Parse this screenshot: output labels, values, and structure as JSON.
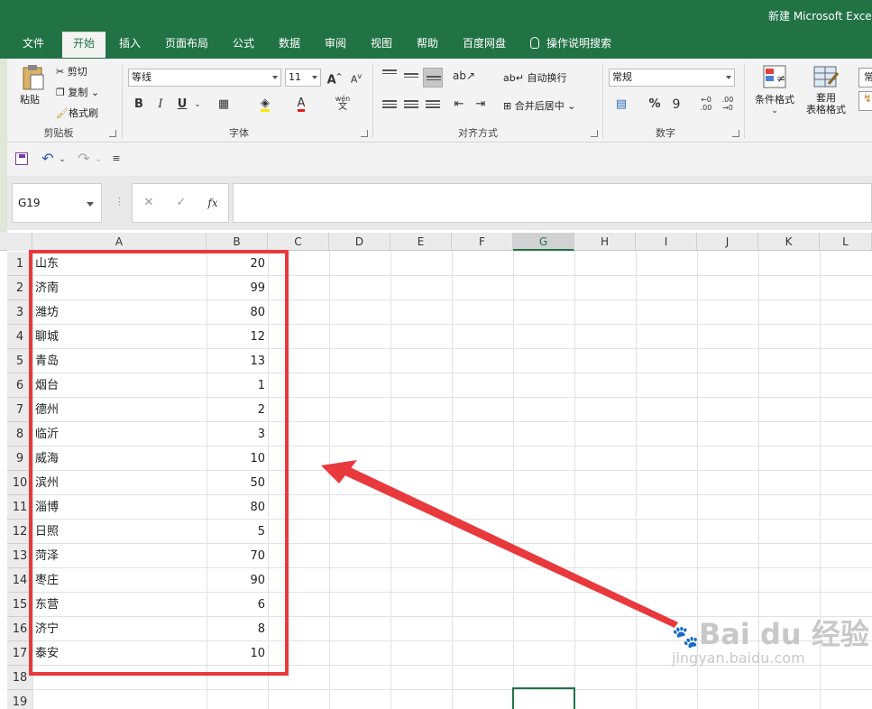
{
  "window": {
    "title": "新建 Microsoft Exce"
  },
  "tabs": [
    "文件",
    "开始",
    "插入",
    "页面布局",
    "公式",
    "数据",
    "审阅",
    "视图",
    "帮助",
    "百度网盘"
  ],
  "active_tab": "开始",
  "tell_me": "操作说明搜索",
  "ribbon": {
    "clipboard": {
      "paste": "粘贴",
      "cut": "剪切",
      "copy": "复制",
      "format_painter": "格式刷",
      "label": "剪贴板"
    },
    "font": {
      "name": "等线",
      "size": "11",
      "bold": "B",
      "italic": "I",
      "underline": "U",
      "increase": "A",
      "decrease": "A",
      "font_color": "A",
      "phonetic_top": "wén",
      "phonetic_bottom": "文",
      "label": "字体"
    },
    "alignment": {
      "wrap": "自动换行",
      "merge": "合并后居中",
      "label": "对齐方式"
    },
    "number": {
      "format": "常规",
      "percent": "%",
      "comma": "9",
      "inc_decimal_top": "←0",
      "inc_decimal_bottom": ".00",
      "dec_decimal_top": ".00",
      "dec_decimal_bottom": "→0",
      "label": "数字"
    },
    "styles": {
      "conditional": "条件格式",
      "table_line1": "套用",
      "table_line2": "表格格式",
      "cell_style": "常"
    }
  },
  "formula_bar": {
    "name_box": "G19",
    "cancel": "✕",
    "enter": "✓",
    "fx": "fx",
    "value": ""
  },
  "columns": [
    "A",
    "B",
    "C",
    "D",
    "E",
    "F",
    "G",
    "H",
    "I",
    "J",
    "K",
    "L"
  ],
  "selected_column": "G",
  "rows": [
    {
      "n": "1",
      "a": "山东",
      "b": "20"
    },
    {
      "n": "2",
      "a": "济南",
      "b": "99"
    },
    {
      "n": "3",
      "a": "潍坊",
      "b": "80"
    },
    {
      "n": "4",
      "a": "聊城",
      "b": "12"
    },
    {
      "n": "5",
      "a": "青岛",
      "b": "13"
    },
    {
      "n": "6",
      "a": "烟台",
      "b": "1"
    },
    {
      "n": "7",
      "a": "德州",
      "b": "2"
    },
    {
      "n": "8",
      "a": "临沂",
      "b": "3"
    },
    {
      "n": "9",
      "a": "威海",
      "b": "10"
    },
    {
      "n": "10",
      "a": "滨州",
      "b": "50"
    },
    {
      "n": "11",
      "a": "淄博",
      "b": "80"
    },
    {
      "n": "12",
      "a": "日照",
      "b": "5"
    },
    {
      "n": "13",
      "a": "菏泽",
      "b": "70"
    },
    {
      "n": "14",
      "a": "枣庄",
      "b": "90"
    },
    {
      "n": "15",
      "a": "东营",
      "b": "6"
    },
    {
      "n": "16",
      "a": "济宁",
      "b": "8"
    },
    {
      "n": "17",
      "a": "泰安",
      "b": "10"
    },
    {
      "n": "18",
      "a": "",
      "b": ""
    },
    {
      "n": "19",
      "a": "",
      "b": ""
    }
  ],
  "watermark": {
    "brand": "Bai du 经验",
    "url": "jingyan.baidu.com"
  },
  "colors": {
    "accent": "#217346",
    "annotation": "#e8393c"
  }
}
